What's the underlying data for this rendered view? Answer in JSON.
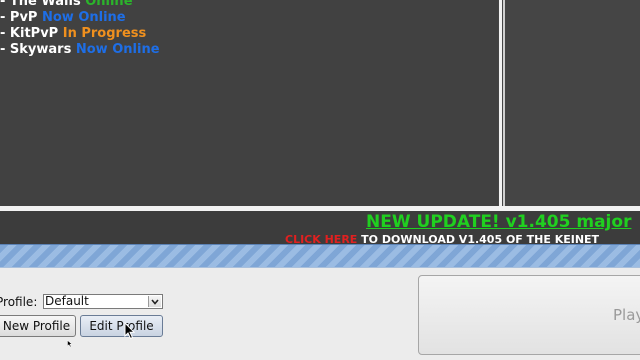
{
  "news": {
    "servers": [
      {
        "name": "- The Walls",
        "status": "Online",
        "status_color": "#2bb52b"
      },
      {
        "name": "- PvP",
        "status": "Now Online",
        "status_color": "#1e6ee6"
      },
      {
        "name": "- KitPvP",
        "status": "In Progress",
        "status_color": "#f0901e"
      },
      {
        "name": "- Skywars",
        "status": "Now Online",
        "status_color": "#1e6ee6"
      }
    ],
    "update_headline": "NEW UPDATE! v1.405 major",
    "update_click": "CLICK HERE",
    "update_text": "TO DOWNLOAD V1.405 OF THE KEINET"
  },
  "profile": {
    "label": "Profile:",
    "selected": "Default",
    "new_button": "New Profile",
    "edit_button": "Edit Profile"
  },
  "play": {
    "label": "Play"
  },
  "colors": {
    "headline": "#20d020",
    "click_here": "#e02020",
    "stripe": "#7fa6d6"
  },
  "icons": {
    "dropdown": "chevron-down-icon",
    "cursor": "mouse-pointer-icon"
  }
}
